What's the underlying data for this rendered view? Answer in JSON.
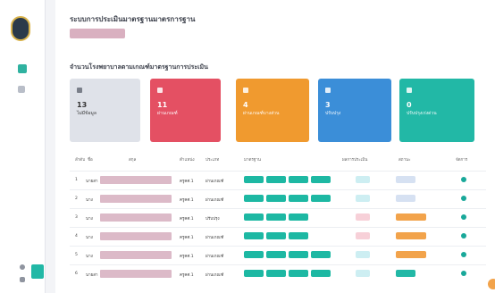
{
  "header": {
    "title": "ระบบการประเมินมาตรฐานมาตรการฐาน"
  },
  "section": {
    "title": "จำนวนโรงพยาบาลตามเกณฑ์มาตรฐานการประเมิน"
  },
  "cards": [
    {
      "value": "13",
      "label": "ไม่มีข้อมูล"
    },
    {
      "value": "11",
      "label": "ผ่านเกณฑ์"
    },
    {
      "value": "4",
      "label": "ผ่านเกณฑ์บางส่วน"
    },
    {
      "value": "3",
      "label": "ปรับปรุง"
    },
    {
      "value": "0",
      "label": "ปรับปรุงเร่งด่วน"
    }
  ],
  "table": {
    "headers": [
      "ลำดับ",
      "ชื่อ",
      "สกุล",
      "ตำแหน่ง",
      "ประเภท",
      "มาตรฐาน",
      "ผลการประเมิน",
      "สถานะ",
      "จัดการ"
    ],
    "rows": [
      {
        "no": "1",
        "name": "นายสา",
        "c3": "ครูคศ.1",
        "c4": "ผ่านเกณฑ์"
      },
      {
        "no": "2",
        "name": "นาง",
        "c3": "ครูคศ.1",
        "c4": "ผ่านเกณฑ์"
      },
      {
        "no": "3",
        "name": "นาง",
        "c3": "ครูคศ.1",
        "c4": "ปรับปรุง"
      },
      {
        "no": "4",
        "name": "นาง",
        "c3": "ครูคศ.1",
        "c4": "ผ่านเกณฑ์"
      },
      {
        "no": "5",
        "name": "นาง",
        "c3": "ครูคศ.1",
        "c4": "ผ่านเกณฑ์"
      },
      {
        "no": "6",
        "name": "นายสา",
        "c3": "ครูคศ.1",
        "c4": "ผ่านเกณฑ์"
      }
    ]
  },
  "colors": {
    "red": "#e45063",
    "orange": "#f09a2f",
    "blue": "#3b8ed8",
    "teal": "#22b8a6",
    "grey": "#dfe2e9"
  }
}
